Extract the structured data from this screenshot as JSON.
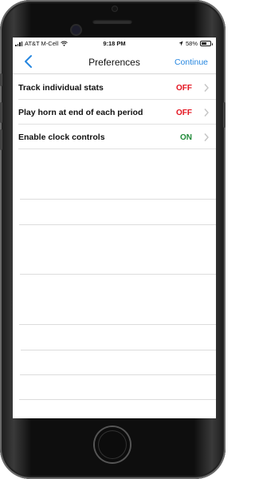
{
  "status_bar": {
    "carrier": "AT&T M-Cell",
    "time": "9:18 PM",
    "battery_text": "58%",
    "battery_level": 0.58
  },
  "nav": {
    "title": "Preferences",
    "continue_label": "Continue",
    "back_icon": "chevron-left-icon"
  },
  "settings": [
    {
      "label": "Track individual stats",
      "value": "OFF",
      "state": "off"
    },
    {
      "label": "Play horn at end of each period",
      "value": "OFF",
      "state": "off"
    },
    {
      "label": "Enable clock controls",
      "value": "ON",
      "state": "on"
    }
  ],
  "colors": {
    "accent": "#2787e0",
    "off": "#e4131f",
    "on": "#1f8a38"
  }
}
